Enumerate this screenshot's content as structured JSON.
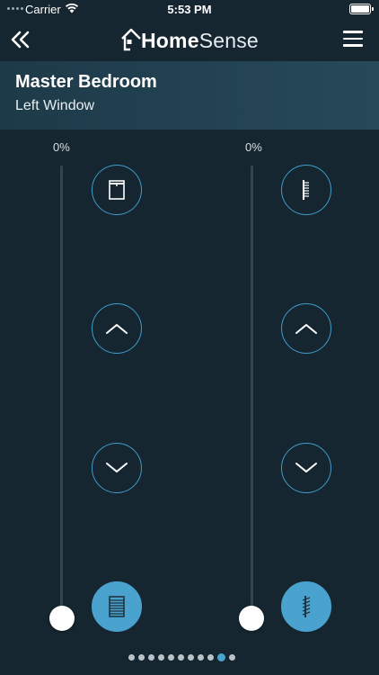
{
  "status_bar": {
    "carrier": "Carrier",
    "time": "5:53 PM"
  },
  "nav": {
    "logo_bold": "Home",
    "logo_light": "Sense"
  },
  "header": {
    "room": "Master Bedroom",
    "window": "Left Window"
  },
  "left_control": {
    "percent_label": "0%",
    "position_percent": 0
  },
  "right_control": {
    "percent_label": "0%",
    "position_percent": 0
  },
  "pagination": {
    "total": 11,
    "active_index": 9
  },
  "colors": {
    "background": "#152630",
    "accent": "#4aa3cf"
  }
}
